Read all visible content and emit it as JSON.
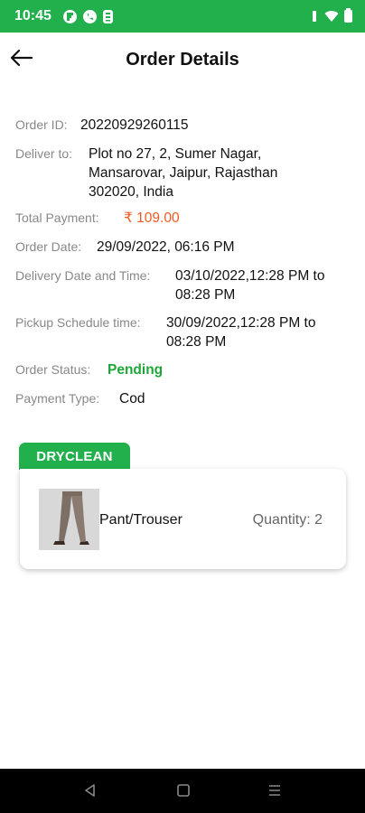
{
  "status_bar": {
    "time": "10:45",
    "left_icons": [
      "flipboard-icon",
      "whatsapp-icon",
      "phone-badge-icon"
    ],
    "right_icons": [
      "vibrate-icon",
      "wifi-icon",
      "battery-icon"
    ]
  },
  "header": {
    "title": "Order Details",
    "back_icon": "arrow-left-icon"
  },
  "order": {
    "order_id_label": "Order ID:",
    "order_id": "20220929260115",
    "deliver_to_label": "Deliver to:",
    "deliver_to_lines": [
      "Plot no 27, 2, Sumer Nagar,",
      "Mansarovar, Jaipur, Rajasthan",
      "302020, India"
    ],
    "total_payment_label": "Total Payment:",
    "total_payment": "₹ 109.00",
    "order_date_label": "Order Date:",
    "order_date": "29/09/2022, 06:16 PM",
    "delivery_label": "Delivery Date and Time:",
    "delivery_lines": [
      "03/10/2022,12:28 PM to",
      "08:28 PM"
    ],
    "pickup_label": "Pickup Schedule time:",
    "pickup_lines": [
      "30/09/2022,12:28 PM to",
      "08:28 PM"
    ],
    "status_label": "Order Status:",
    "status": "Pending",
    "payment_type_label": "Payment Type:",
    "payment_type": "Cod"
  },
  "service": {
    "tag": "DRYCLEAN",
    "items": [
      {
        "name": "Pant/Trouser",
        "quantity": "Quantity: 2",
        "image": "trouser-photo"
      }
    ]
  },
  "colors": {
    "brand_green": "#21b04b",
    "price_orange": "#f05a22",
    "status_green": "#1fa63a"
  },
  "nav": {
    "buttons": [
      "back-triangle-icon",
      "home-square-icon",
      "menu-lines-icon"
    ]
  }
}
